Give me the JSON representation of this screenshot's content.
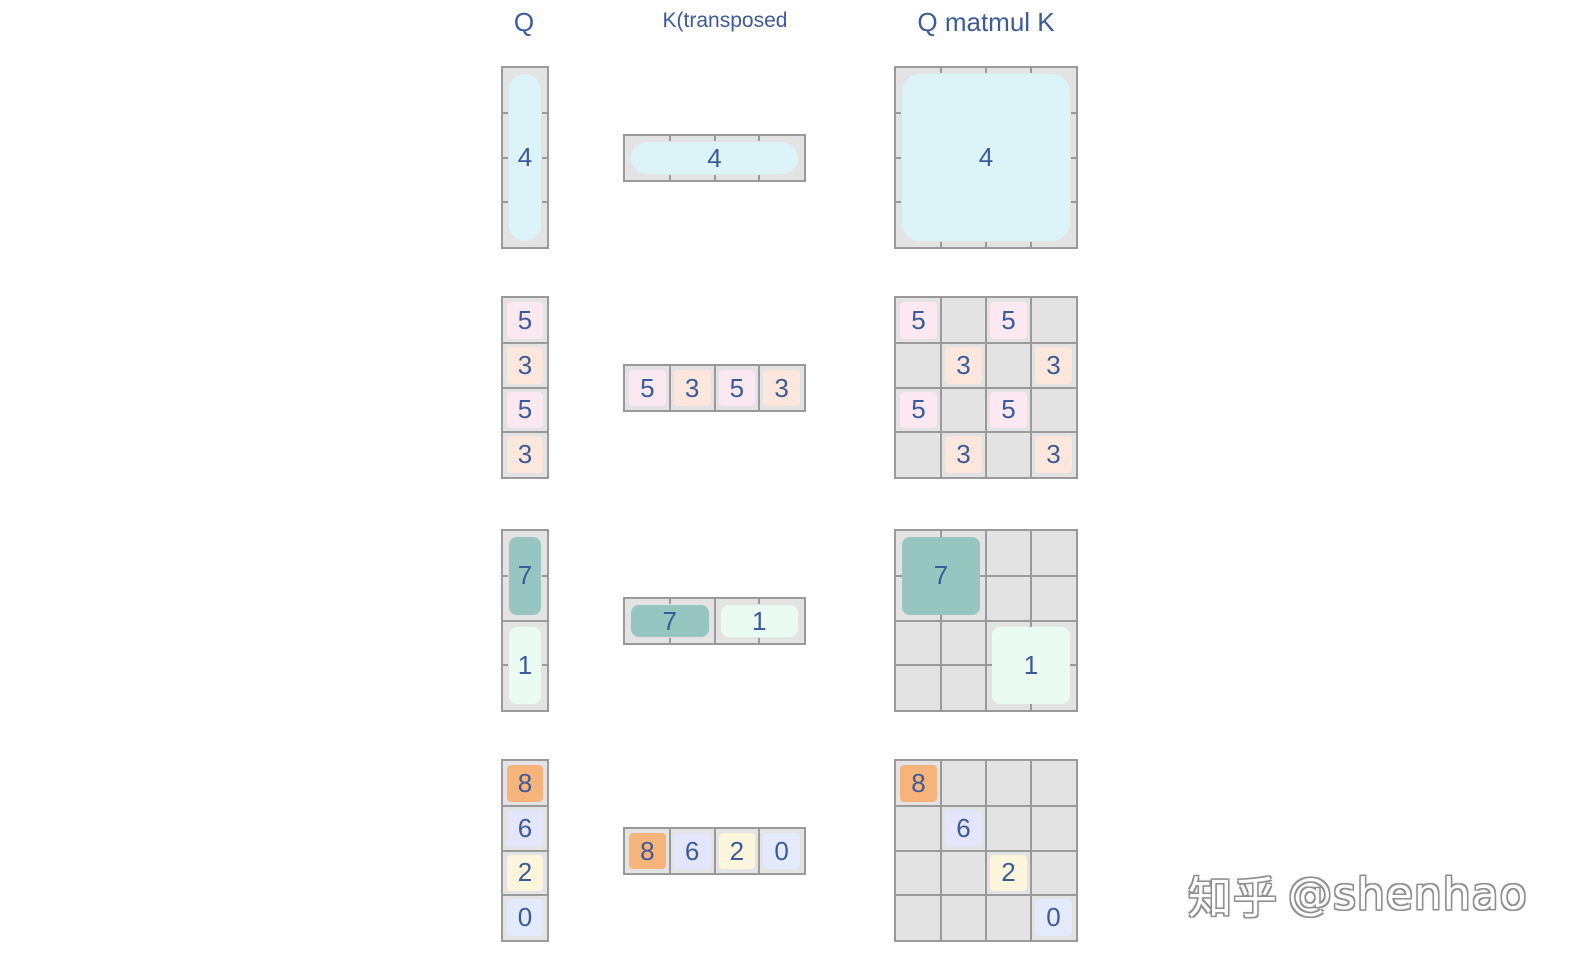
{
  "headers": {
    "q": "Q",
    "k": "K(transposed",
    "result": "Q matmul K"
  },
  "colors": {
    "grid_border": "#9a9a9a",
    "grid_fill": "#e3e3e3",
    "text": "#3d5a99",
    "cell_4": "#dcf4f8",
    "cell_5": "#fce8f1",
    "cell_3": "#fde6dc",
    "cell_7": "#97c5bf",
    "cell_1": "#eafbf2",
    "cell_8": "#f7b47a",
    "cell_6": "#e3e6fb",
    "cell_2": "#fdf6dc",
    "cell_0": "#e2eafb"
  },
  "rows": [
    {
      "q": [
        {
          "label": "4",
          "color": "#dcf4f8"
        }
      ],
      "k": [
        {
          "label": "4",
          "color": "#dcf4f8"
        }
      ],
      "result": [
        {
          "label": "4",
          "color": "#dcf4f8"
        }
      ]
    },
    {
      "q": [
        {
          "label": "5",
          "color": "#fce8f1"
        },
        {
          "label": "3",
          "color": "#fde6dc"
        },
        {
          "label": "5",
          "color": "#fce8f1"
        },
        {
          "label": "3",
          "color": "#fde6dc"
        }
      ],
      "k": [
        {
          "label": "5",
          "color": "#fce8f1"
        },
        {
          "label": "3",
          "color": "#fde6dc"
        },
        {
          "label": "5",
          "color": "#fce8f1"
        },
        {
          "label": "3",
          "color": "#fde6dc"
        }
      ],
      "result": [
        {
          "label": "5",
          "color": "#fce8f1"
        },
        {
          "label": "5",
          "color": "#fce8f1"
        },
        {
          "label": "3",
          "color": "#fde6dc"
        },
        {
          "label": "3",
          "color": "#fde6dc"
        },
        {
          "label": "5",
          "color": "#fce8f1"
        },
        {
          "label": "5",
          "color": "#fce8f1"
        },
        {
          "label": "3",
          "color": "#fde6dc"
        },
        {
          "label": "3",
          "color": "#fde6dc"
        }
      ]
    },
    {
      "q": [
        {
          "label": "7",
          "color": "#97c5bf"
        },
        {
          "label": "1",
          "color": "#eafbf2"
        }
      ],
      "k": [
        {
          "label": "7",
          "color": "#97c5bf"
        },
        {
          "label": "1",
          "color": "#eafbf2"
        }
      ],
      "result": [
        {
          "label": "7",
          "color": "#97c5bf"
        },
        {
          "label": "1",
          "color": "#eafbf2"
        }
      ]
    },
    {
      "q": [
        {
          "label": "8",
          "color": "#f7b47a"
        },
        {
          "label": "6",
          "color": "#e3e6fb"
        },
        {
          "label": "2",
          "color": "#fdf6dc"
        },
        {
          "label": "0",
          "color": "#e2eafb"
        }
      ],
      "k": [
        {
          "label": "8",
          "color": "#f7b47a"
        },
        {
          "label": "6",
          "color": "#e3e6fb"
        },
        {
          "label": "2",
          "color": "#fdf6dc"
        },
        {
          "label": "0",
          "color": "#e2eafb"
        }
      ],
      "result": [
        {
          "label": "8",
          "color": "#f7b47a"
        },
        {
          "label": "6",
          "color": "#e3e6fb"
        },
        {
          "label": "2",
          "color": "#fdf6dc"
        },
        {
          "label": "0",
          "color": "#e2eafb"
        }
      ]
    }
  ],
  "watermark": {
    "site": "知乎",
    "handle": "@shenhao"
  }
}
